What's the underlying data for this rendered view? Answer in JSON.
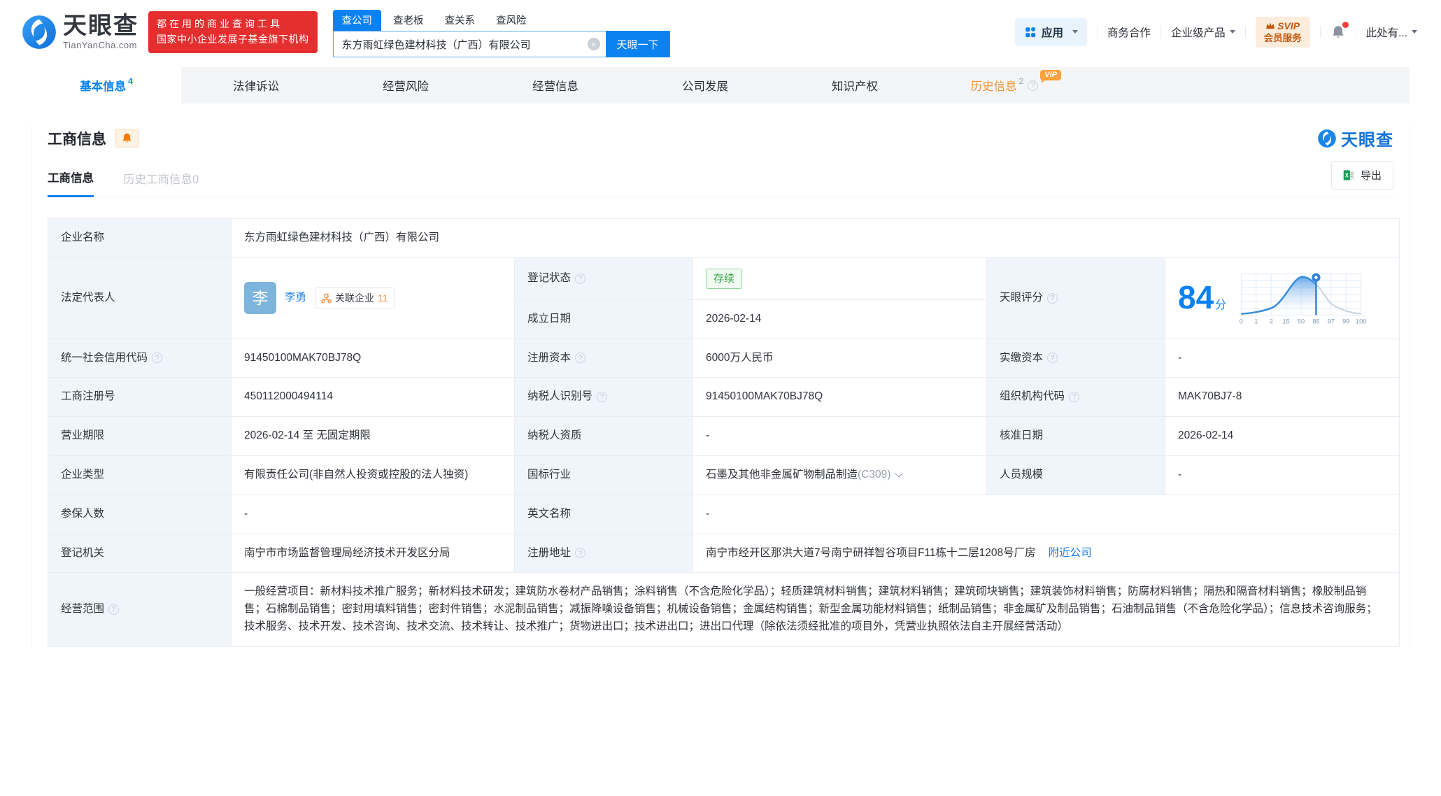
{
  "header": {
    "logo_brand": "天眼查",
    "logo_domain": "TianYanCha.com",
    "promo_line1": "都在用的商业查询工具",
    "promo_line2": "国家中小企业发展子基金旗下机构",
    "search_tabs": [
      {
        "label": "查公司",
        "active": true
      },
      {
        "label": "查老板",
        "active": false
      },
      {
        "label": "查关系",
        "active": false
      },
      {
        "label": "查风险",
        "active": false
      }
    ],
    "search_value": "东方雨虹绿色建材科技（广西）有限公司",
    "search_button": "天眼一下",
    "nav": {
      "apps": "应用",
      "cooperation": "商务合作",
      "enterprise": "企业级产品",
      "svip_top": "SVIP",
      "svip_bottom": "会员服务",
      "more": "此处有..."
    }
  },
  "main_tabs": [
    {
      "label": "基本信息",
      "count": "4",
      "active": true
    },
    {
      "label": "法律诉讼"
    },
    {
      "label": "经营风险"
    },
    {
      "label": "经营信息"
    },
    {
      "label": "公司发展"
    },
    {
      "label": "知识产权"
    },
    {
      "label": "历史信息",
      "count": "2",
      "vip": "VIP"
    }
  ],
  "section": {
    "title": "工商信息",
    "watermark": "天眼查",
    "subtab_active": "工商信息",
    "subtab_history": "历史工商信息0",
    "export_label": "导出"
  },
  "fields": {
    "company_name_label": "企业名称",
    "company_name": "东方雨虹绿色建材科技（广西）有限公司",
    "legal_rep_label": "法定代表人",
    "legal_rep_avatar": "李",
    "legal_rep_name": "李勇",
    "related_label": "关联企业",
    "related_count": "11",
    "reg_status_label": "登记状态",
    "reg_status": "存续",
    "est_date_label": "成立日期",
    "est_date": "2026-02-14",
    "score_label": "天眼评分",
    "score": "84",
    "score_unit": "分",
    "credit_code_label": "统一社会信用代码",
    "credit_code": "91450100MAK70BJ78Q",
    "reg_capital_label": "注册资本",
    "reg_capital": "6000万人民币",
    "paid_capital_label": "实缴资本",
    "paid_capital": "-",
    "reg_number_label": "工商注册号",
    "reg_number": "450112000494114",
    "taxpayer_id_label": "纳税人识别号",
    "taxpayer_id": "91450100MAK70BJ78Q",
    "org_code_label": "组织机构代码",
    "org_code": "MAK70BJ7-8",
    "biz_term_label": "营业期限",
    "biz_term": "2026-02-14 至 无固定期限",
    "taxpayer_quals_label": "纳税人资质",
    "taxpayer_quals": "-",
    "approval_date_label": "核准日期",
    "approval_date": "2026-02-14",
    "company_type_label": "企业类型",
    "company_type": "有限责任公司(非自然人投资或控股的法人独资)",
    "industry_label": "国标行业",
    "industry": "石墨及其他非金属矿物制品制造",
    "industry_code": "(C309)",
    "staff_size_label": "人员规模",
    "staff_size": "-",
    "insured_label": "参保人数",
    "insured": "-",
    "english_name_label": "英文名称",
    "english_name": "-",
    "reg_authority_label": "登记机关",
    "reg_authority": "南宁市市场监督管理局经济技术开发区分局",
    "address_label": "注册地址",
    "address": "南宁市经开区那洪大道7号南宁研祥智谷项目F11栋十二层1208号厂房",
    "nearby_link": "附近公司",
    "scope_label": "经营范围",
    "scope": "一般经营项目：新材料技术推广服务；新材料技术研发；建筑防水卷材产品销售；涂料销售（不含危险化学品）；轻质建筑材料销售；建筑材料销售；建筑砌块销售；建筑装饰材料销售；防腐材料销售；隔热和隔音材料销售；橡胶制品销售；石棉制品销售；密封用填料销售；密封件销售；水泥制品销售；减振降噪设备销售；机械设备销售；金属结构销售；新型金属功能材料销售；纸制品销售；非金属矿及制品销售；石油制品销售（不含危险化学品）；信息技术咨询服务；技术服务、技术开发、技术咨询、技术交流、技术转让、技术推广；货物进出口；技术进出口；进出口代理（除依法须经批准的项目外，凭营业执照依法自主开展经营活动）"
  },
  "chart_data": {
    "type": "area",
    "title": "天眼评分",
    "score_value": 84,
    "score_unit": "分",
    "x_ticks": [
      "0",
      "1",
      "3",
      "15",
      "50",
      "85",
      "97",
      "99",
      "100"
    ],
    "marker_tick": "85",
    "curve_relative_heights": [
      0.03,
      0.06,
      0.18,
      0.5,
      1.0,
      0.8,
      0.27,
      0.1,
      0.03
    ],
    "grid": true,
    "legend": "none",
    "colors": {
      "curve": "#358ae0",
      "marker": "#2f7fd8",
      "inactive": "#c6d2df",
      "grid": "#dde9f6",
      "axis_label": "#7f9cba"
    }
  },
  "colors": {
    "brand_blue": "#0b82f0",
    "promo_red": "#e52f2f",
    "status_green": "#3fa24e",
    "vip_orange": "#f9a13c"
  }
}
